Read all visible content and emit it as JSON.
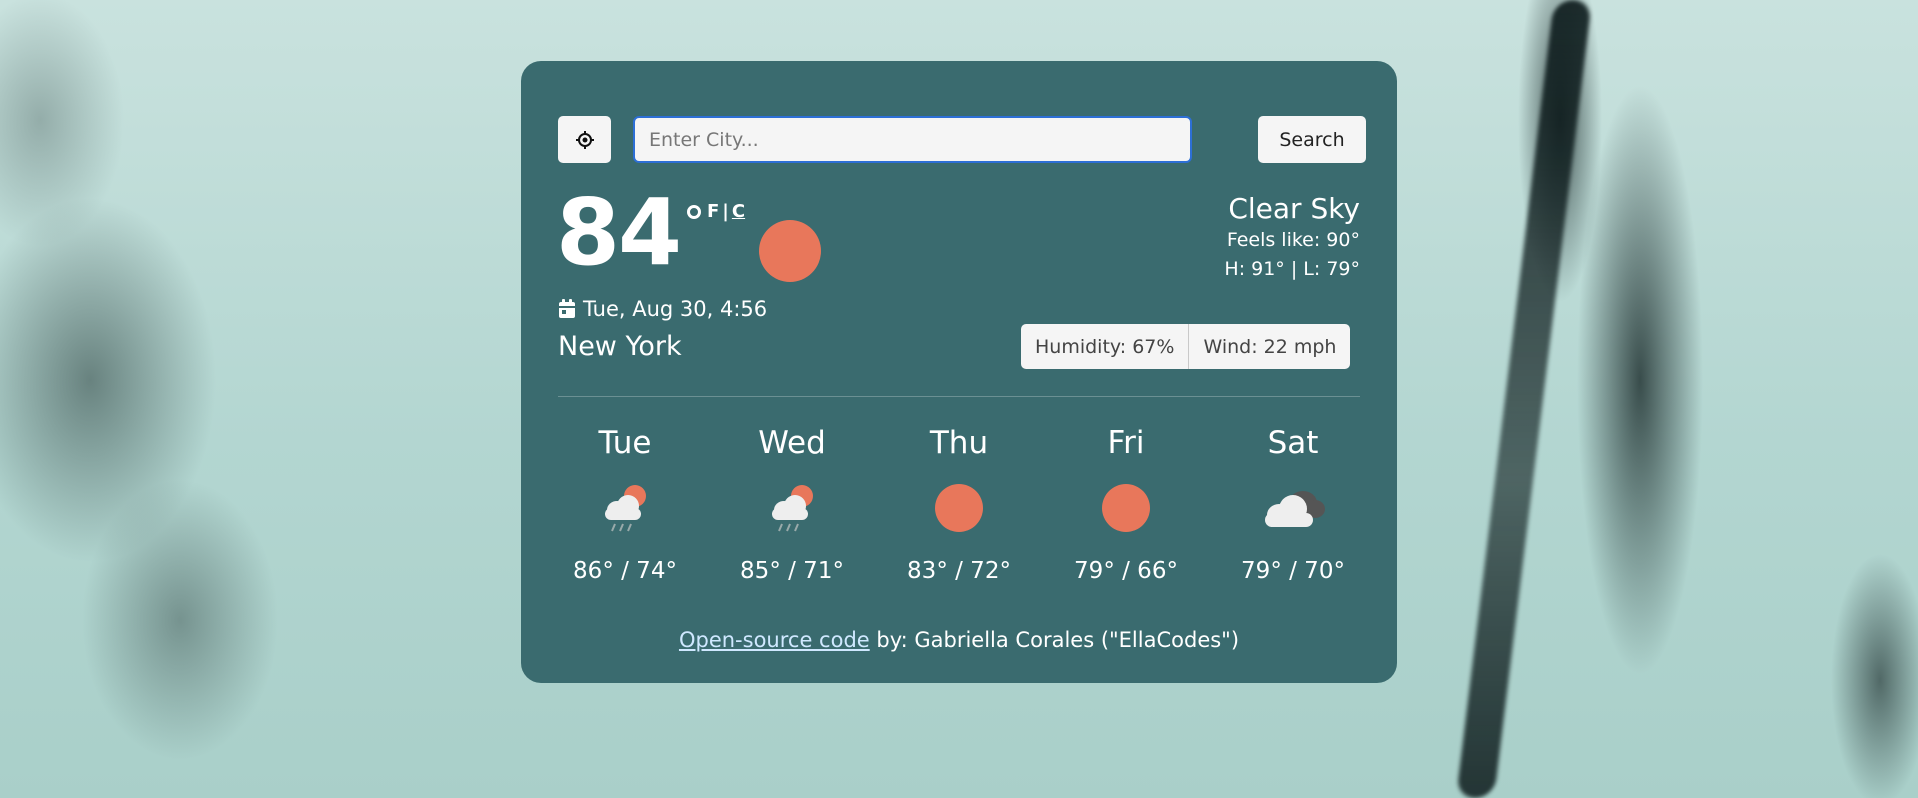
{
  "search": {
    "placeholder": "Enter City...",
    "button_label": "Search"
  },
  "current": {
    "temperature": "84",
    "unit_f": "F",
    "unit_separator": "|",
    "unit_c": "C",
    "date": "Tue, Aug 30, 4:56",
    "city": "New York",
    "description": "Clear Sky",
    "feels_like": "Feels like: 90°",
    "high_low": "H: 91° | L: 79°",
    "humidity": "Humidity: 67%",
    "wind": "Wind: 22 mph",
    "icon": "sun-icon"
  },
  "forecast": [
    {
      "day": "Tue",
      "temps": "86° / 74°",
      "icon": "thunderstorm-icon"
    },
    {
      "day": "Wed",
      "temps": "85° / 71°",
      "icon": "thunderstorm-icon"
    },
    {
      "day": "Thu",
      "temps": "83° / 72°",
      "icon": "sun-icon"
    },
    {
      "day": "Fri",
      "temps": "79° / 66°",
      "icon": "sun-icon"
    },
    {
      "day": "Sat",
      "temps": "79° / 70°",
      "icon": "cloudy-icon"
    }
  ],
  "footer": {
    "link_text": "Open-source code",
    "byline": " by: Gabriella Corales (\"EllaCodes\")"
  },
  "colors": {
    "card_bg": "#3a6b6f",
    "sun": "#e8775b",
    "input_border": "#2d6fd6",
    "link": "#cfe8ff"
  }
}
